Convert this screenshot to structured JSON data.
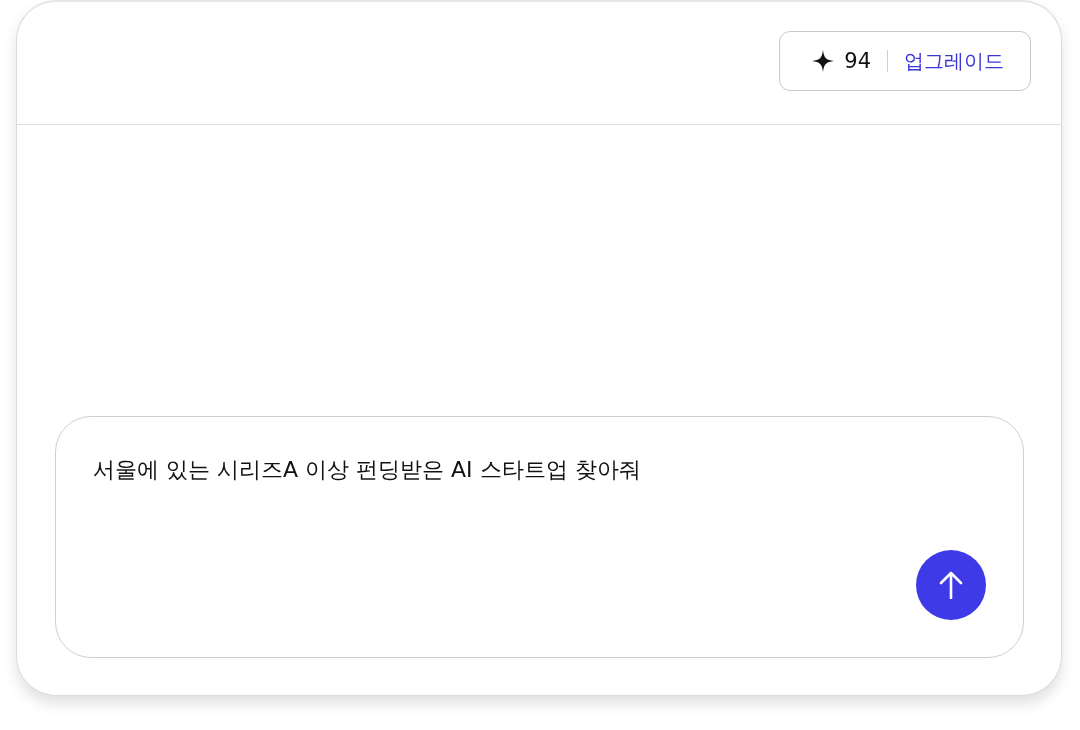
{
  "header": {
    "credits": "94",
    "upgrade_link": "업그레이드"
  },
  "composer": {
    "value": "서울에 있는 시리즈A 이상 펀딩받은 AI 스타트업 찾아줘"
  }
}
